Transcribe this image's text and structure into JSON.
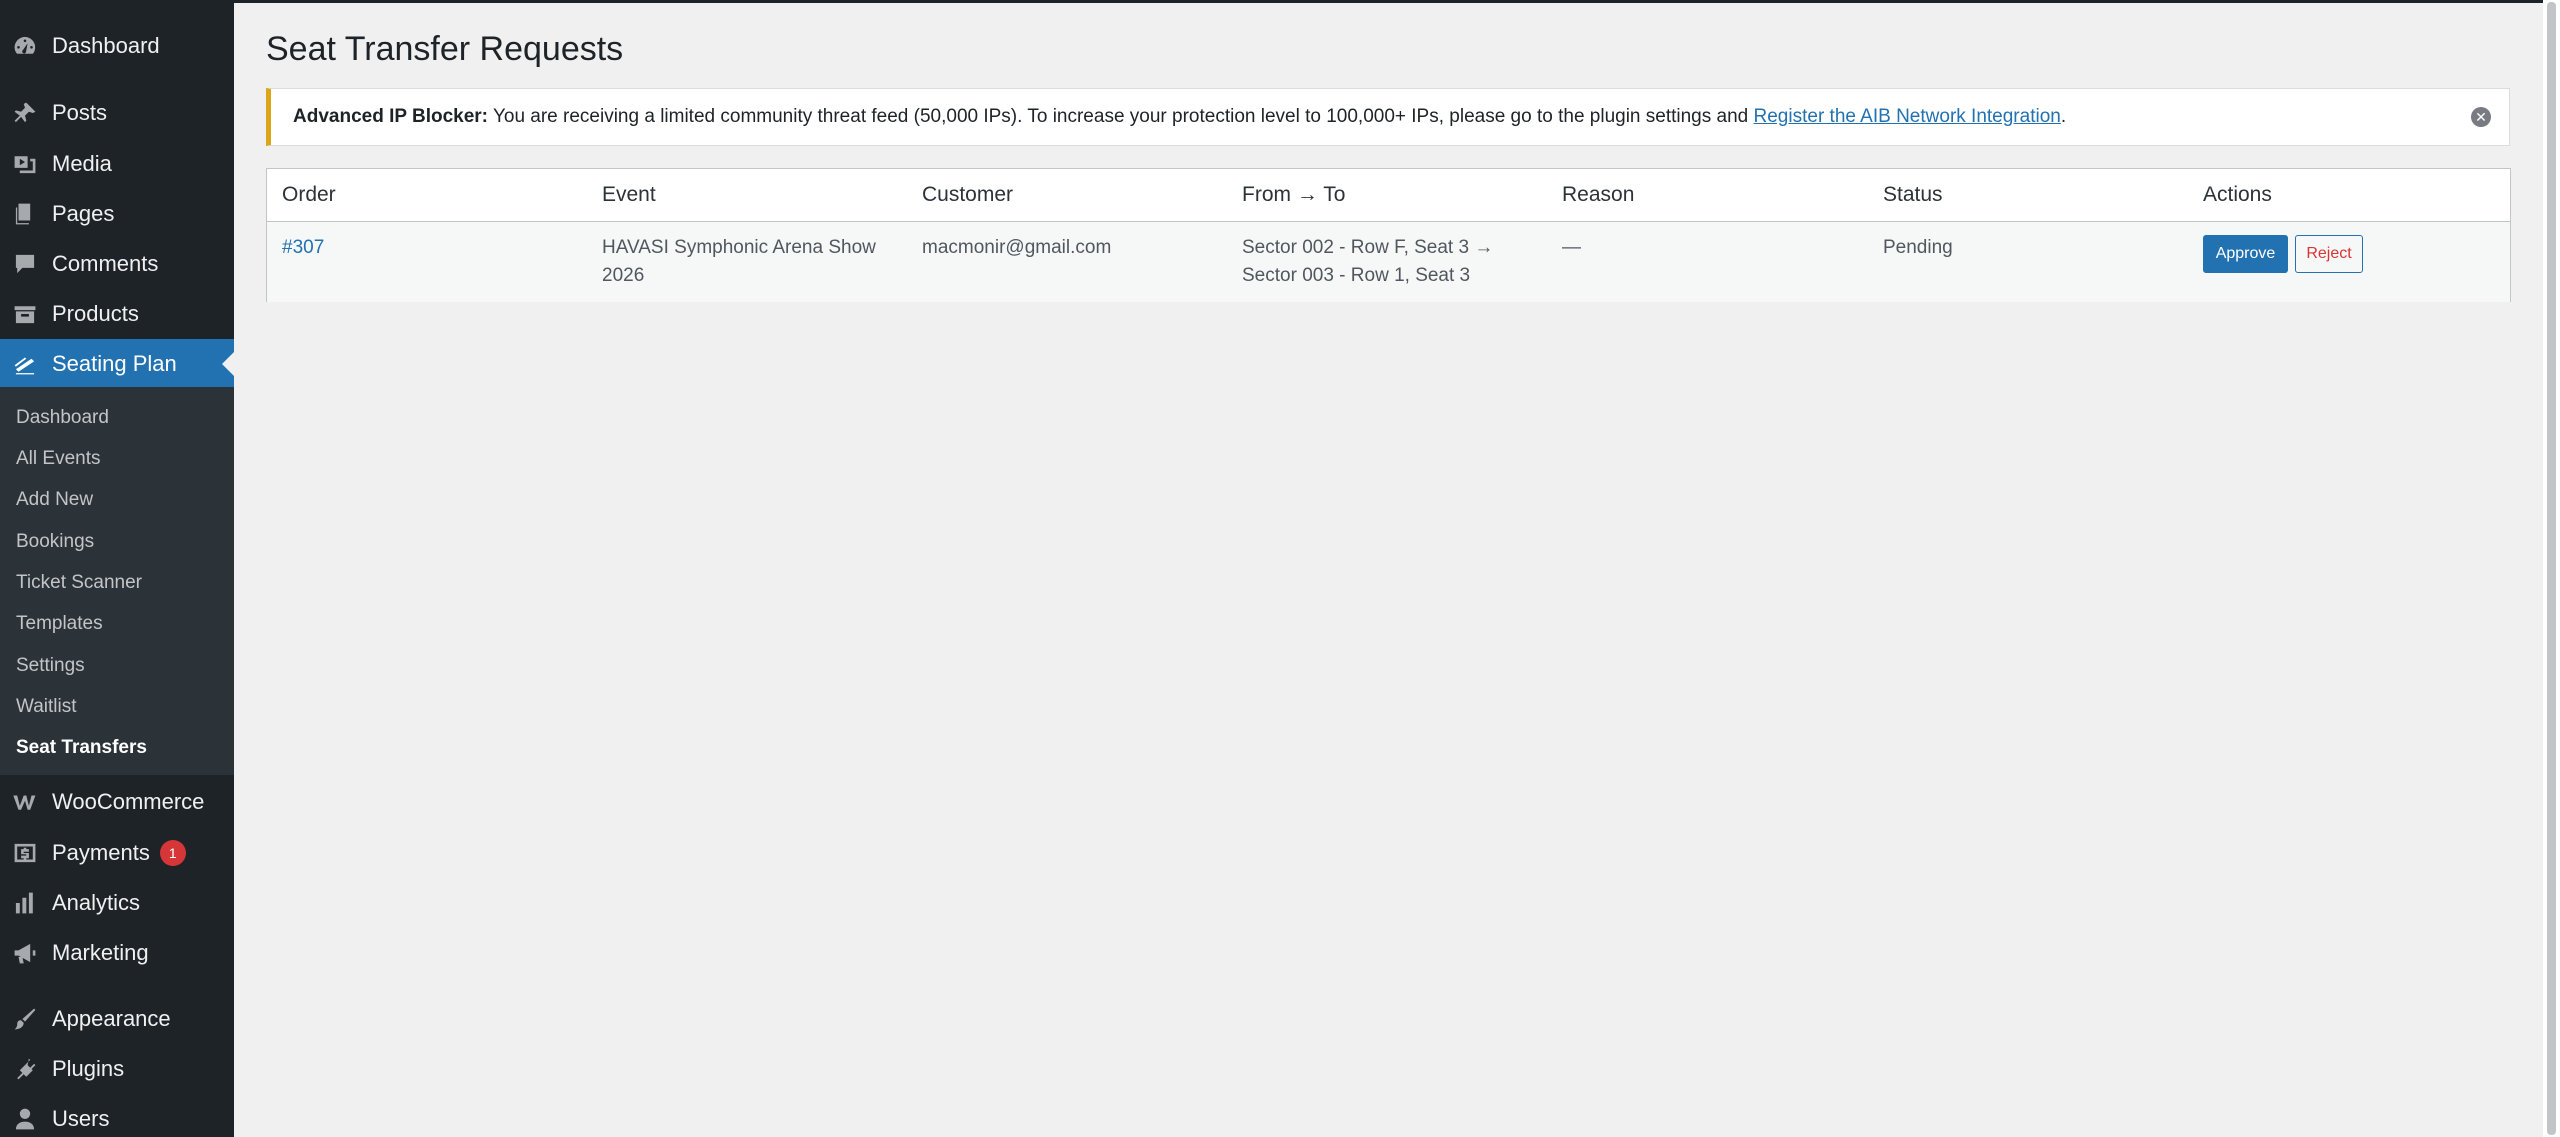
{
  "sidebar": {
    "dashboard": "Dashboard",
    "posts": "Posts",
    "media": "Media",
    "pages": "Pages",
    "comments": "Comments",
    "products": "Products",
    "seating_plan": "Seating Plan",
    "submenu": [
      "Dashboard",
      "All Events",
      "Add New",
      "Bookings",
      "Ticket Scanner",
      "Templates",
      "Settings",
      "Waitlist",
      "Seat Transfers"
    ],
    "woocommerce": "WooCommerce",
    "payments": "Payments",
    "payments_badge": "1",
    "analytics": "Analytics",
    "marketing": "Marketing",
    "appearance": "Appearance",
    "plugins": "Plugins",
    "users": "Users"
  },
  "page": {
    "title": "Seat Transfer Requests"
  },
  "notice": {
    "label": "Advanced IP Blocker:",
    "text": " You are receiving a limited community threat feed (50,000 IPs). To increase your protection level to 100,000+ IPs, please go to the plugin settings and ",
    "link": "Register the AIB Network Integration",
    "end": "."
  },
  "table": {
    "headers": [
      "Order",
      "Event",
      "Customer",
      "From → To",
      "Reason",
      "Status",
      "Actions"
    ],
    "rows": [
      {
        "order": "#307",
        "event_line1": "HAVASI Symphonic Arena Show",
        "event_line2": "2026",
        "customer": "macmonir@gmail.com",
        "from_line1": "Sector 002 - Row F, Seat 3 →",
        "from_line2": "Sector 003 - Row 1, Seat 3",
        "reason": "—",
        "status": "Pending",
        "approve": "Approve",
        "reject": "Reject"
      }
    ]
  },
  "colors": {
    "sidebar_bg": "#1d2327",
    "submenu_bg": "#2c3338",
    "accent": "#2271b1",
    "notice_border": "#dba617",
    "reject_text": "#d63638"
  }
}
